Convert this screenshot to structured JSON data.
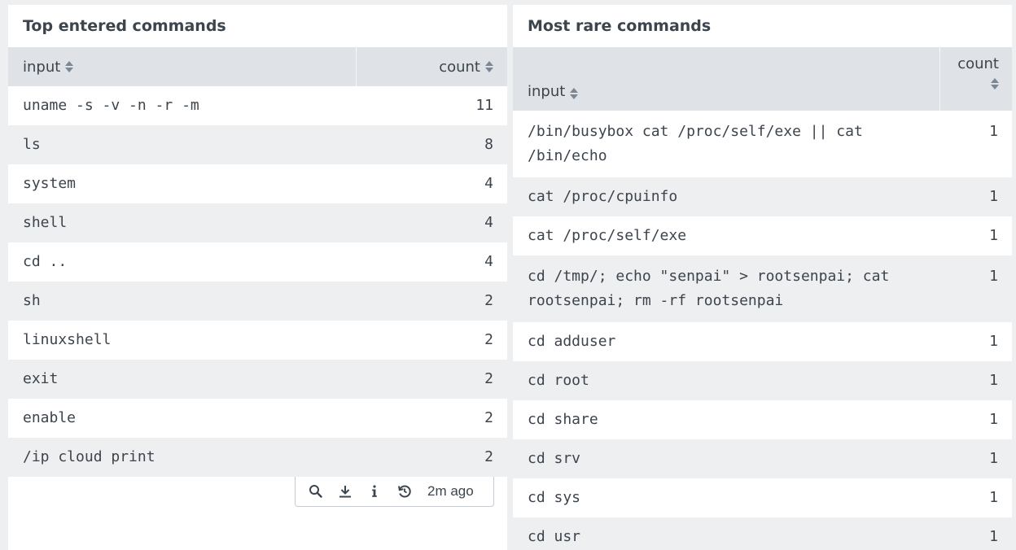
{
  "left_panel": {
    "title": "Top entered commands",
    "columns": {
      "input": "input",
      "count": "count"
    },
    "rows": [
      {
        "input": "uname -s -v -n -r -m",
        "count": "11"
      },
      {
        "input": "ls",
        "count": "8"
      },
      {
        "input": "system",
        "count": "4"
      },
      {
        "input": "shell",
        "count": "4"
      },
      {
        "input": "cd ..",
        "count": "4"
      },
      {
        "input": "sh",
        "count": "2"
      },
      {
        "input": "linuxshell",
        "count": "2"
      },
      {
        "input": "exit",
        "count": "2"
      },
      {
        "input": "enable",
        "count": "2"
      },
      {
        "input": "/ip cloud print",
        "count": "2"
      }
    ],
    "toolbar": {
      "icons": [
        "search-icon",
        "download-icon",
        "info-icon",
        "refresh-icon"
      ],
      "last_updated": "2m ago"
    }
  },
  "right_panel": {
    "title": "Most rare commands",
    "columns": {
      "input": "input",
      "count": "count"
    },
    "rows": [
      {
        "input": "/bin/busybox cat /proc/self/exe || cat /bin/echo",
        "count": "1"
      },
      {
        "input": "cat /proc/cpuinfo",
        "count": "1"
      },
      {
        "input": "cat /proc/self/exe",
        "count": "1"
      },
      {
        "input": "cd /tmp/; echo \"senpai\" > rootsenpai; cat rootsenpai; rm -rf rootsenpai",
        "count": "1"
      },
      {
        "input": "cd adduser",
        "count": "1"
      },
      {
        "input": "cd root",
        "count": "1"
      },
      {
        "input": "cd share",
        "count": "1"
      },
      {
        "input": "cd srv",
        "count": "1"
      },
      {
        "input": "cd sys",
        "count": "1"
      },
      {
        "input": "cd usr",
        "count": "1"
      }
    ]
  }
}
